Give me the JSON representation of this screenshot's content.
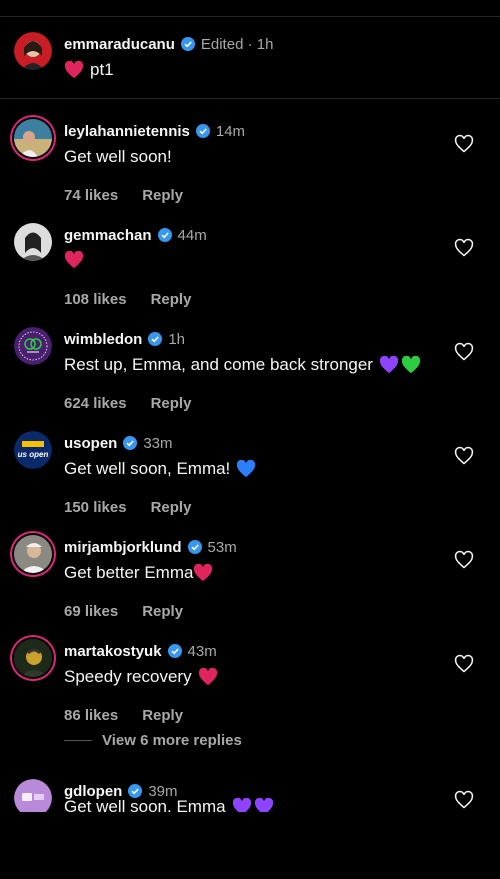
{
  "post": {
    "user": "emmaraducanu",
    "meta": "Edited · 1h",
    "text": "pt1",
    "emoji": "heart-red"
  },
  "comments": [
    {
      "user": "leylahannietennis",
      "time": "14m",
      "text": "Get well soon!",
      "emoji": "",
      "likes": "74 likes",
      "reply": "Reply"
    },
    {
      "user": "gemmachan",
      "time": "44m",
      "text": "",
      "emoji": "heart-red",
      "likes": "108 likes",
      "reply": "Reply"
    },
    {
      "user": "wimbledon",
      "time": "1h",
      "text": "Rest up, Emma, and come back stronger",
      "emoji": "purple-green-hearts",
      "likes": "624 likes",
      "reply": "Reply"
    },
    {
      "user": "usopen",
      "time": "33m",
      "text": "Get well soon, Emma!",
      "emoji": "heart-blue",
      "likes": "150 likes",
      "reply": "Reply"
    },
    {
      "user": "mirjambjorklund",
      "time": "53m",
      "text": "Get better Emma",
      "emoji": "heart-red",
      "likes": "69 likes",
      "reply": "Reply"
    },
    {
      "user": "martakostyuk",
      "time": "43m",
      "text": "Speedy recovery",
      "emoji": "heart-red",
      "likes": "86 likes",
      "reply": "Reply"
    },
    {
      "user": "gdlopen",
      "time": "39m",
      "text": "Get well soon, Emma",
      "emoji": "purple-hearts",
      "likes": "",
      "reply": ""
    }
  ],
  "view_more": "View 6 more replies",
  "logos": {
    "usopen": "us open"
  },
  "colors": {
    "verified": "#3897f0",
    "heart_red": "#e0245e",
    "heart_purple": "#8e44ff",
    "heart_green": "#2ecc40",
    "heart_blue": "#2a7fff"
  }
}
